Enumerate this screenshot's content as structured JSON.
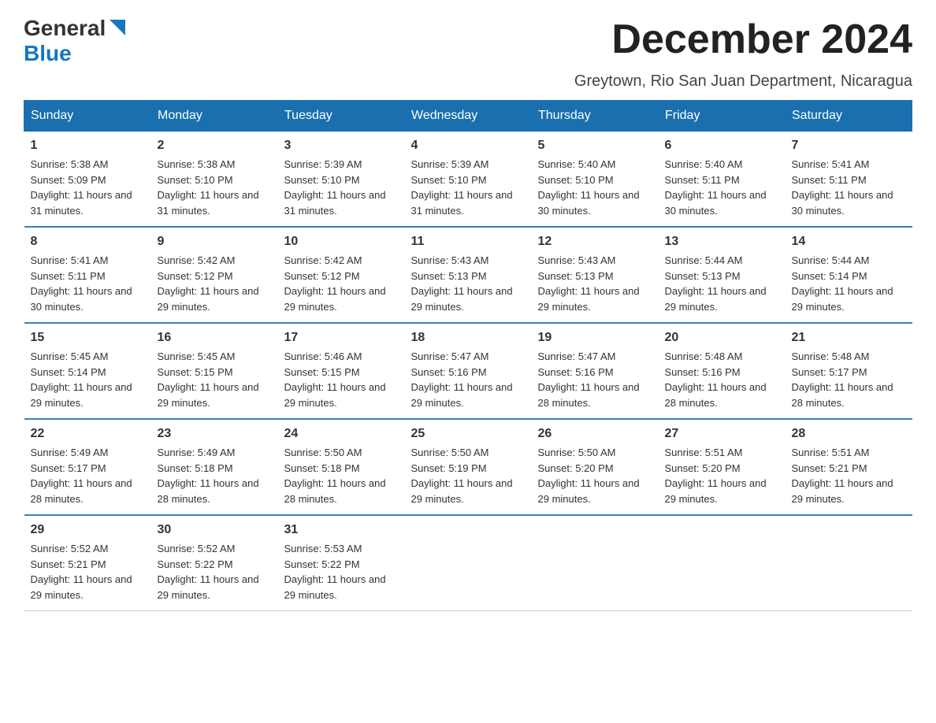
{
  "header": {
    "logo": {
      "general": "General",
      "blue": "Blue"
    },
    "month_title": "December 2024",
    "location": "Greytown, Rio San Juan Department, Nicaragua"
  },
  "calendar": {
    "days_of_week": [
      "Sunday",
      "Monday",
      "Tuesday",
      "Wednesday",
      "Thursday",
      "Friday",
      "Saturday"
    ],
    "weeks": [
      [
        {
          "day": "1",
          "sunrise": "5:38 AM",
          "sunset": "5:09 PM",
          "daylight": "11 hours and 31 minutes."
        },
        {
          "day": "2",
          "sunrise": "5:38 AM",
          "sunset": "5:10 PM",
          "daylight": "11 hours and 31 minutes."
        },
        {
          "day": "3",
          "sunrise": "5:39 AM",
          "sunset": "5:10 PM",
          "daylight": "11 hours and 31 minutes."
        },
        {
          "day": "4",
          "sunrise": "5:39 AM",
          "sunset": "5:10 PM",
          "daylight": "11 hours and 31 minutes."
        },
        {
          "day": "5",
          "sunrise": "5:40 AM",
          "sunset": "5:10 PM",
          "daylight": "11 hours and 30 minutes."
        },
        {
          "day": "6",
          "sunrise": "5:40 AM",
          "sunset": "5:11 PM",
          "daylight": "11 hours and 30 minutes."
        },
        {
          "day": "7",
          "sunrise": "5:41 AM",
          "sunset": "5:11 PM",
          "daylight": "11 hours and 30 minutes."
        }
      ],
      [
        {
          "day": "8",
          "sunrise": "5:41 AM",
          "sunset": "5:11 PM",
          "daylight": "11 hours and 30 minutes."
        },
        {
          "day": "9",
          "sunrise": "5:42 AM",
          "sunset": "5:12 PM",
          "daylight": "11 hours and 29 minutes."
        },
        {
          "day": "10",
          "sunrise": "5:42 AM",
          "sunset": "5:12 PM",
          "daylight": "11 hours and 29 minutes."
        },
        {
          "day": "11",
          "sunrise": "5:43 AM",
          "sunset": "5:13 PM",
          "daylight": "11 hours and 29 minutes."
        },
        {
          "day": "12",
          "sunrise": "5:43 AM",
          "sunset": "5:13 PM",
          "daylight": "11 hours and 29 minutes."
        },
        {
          "day": "13",
          "sunrise": "5:44 AM",
          "sunset": "5:13 PM",
          "daylight": "11 hours and 29 minutes."
        },
        {
          "day": "14",
          "sunrise": "5:44 AM",
          "sunset": "5:14 PM",
          "daylight": "11 hours and 29 minutes."
        }
      ],
      [
        {
          "day": "15",
          "sunrise": "5:45 AM",
          "sunset": "5:14 PM",
          "daylight": "11 hours and 29 minutes."
        },
        {
          "day": "16",
          "sunrise": "5:45 AM",
          "sunset": "5:15 PM",
          "daylight": "11 hours and 29 minutes."
        },
        {
          "day": "17",
          "sunrise": "5:46 AM",
          "sunset": "5:15 PM",
          "daylight": "11 hours and 29 minutes."
        },
        {
          "day": "18",
          "sunrise": "5:47 AM",
          "sunset": "5:16 PM",
          "daylight": "11 hours and 29 minutes."
        },
        {
          "day": "19",
          "sunrise": "5:47 AM",
          "sunset": "5:16 PM",
          "daylight": "11 hours and 28 minutes."
        },
        {
          "day": "20",
          "sunrise": "5:48 AM",
          "sunset": "5:16 PM",
          "daylight": "11 hours and 28 minutes."
        },
        {
          "day": "21",
          "sunrise": "5:48 AM",
          "sunset": "5:17 PM",
          "daylight": "11 hours and 28 minutes."
        }
      ],
      [
        {
          "day": "22",
          "sunrise": "5:49 AM",
          "sunset": "5:17 PM",
          "daylight": "11 hours and 28 minutes."
        },
        {
          "day": "23",
          "sunrise": "5:49 AM",
          "sunset": "5:18 PM",
          "daylight": "11 hours and 28 minutes."
        },
        {
          "day": "24",
          "sunrise": "5:50 AM",
          "sunset": "5:18 PM",
          "daylight": "11 hours and 28 minutes."
        },
        {
          "day": "25",
          "sunrise": "5:50 AM",
          "sunset": "5:19 PM",
          "daylight": "11 hours and 29 minutes."
        },
        {
          "day": "26",
          "sunrise": "5:50 AM",
          "sunset": "5:20 PM",
          "daylight": "11 hours and 29 minutes."
        },
        {
          "day": "27",
          "sunrise": "5:51 AM",
          "sunset": "5:20 PM",
          "daylight": "11 hours and 29 minutes."
        },
        {
          "day": "28",
          "sunrise": "5:51 AM",
          "sunset": "5:21 PM",
          "daylight": "11 hours and 29 minutes."
        }
      ],
      [
        {
          "day": "29",
          "sunrise": "5:52 AM",
          "sunset": "5:21 PM",
          "daylight": "11 hours and 29 minutes."
        },
        {
          "day": "30",
          "sunrise": "5:52 AM",
          "sunset": "5:22 PM",
          "daylight": "11 hours and 29 minutes."
        },
        {
          "day": "31",
          "sunrise": "5:53 AM",
          "sunset": "5:22 PM",
          "daylight": "11 hours and 29 minutes."
        },
        {
          "day": "",
          "sunrise": "",
          "sunset": "",
          "daylight": ""
        },
        {
          "day": "",
          "sunrise": "",
          "sunset": "",
          "daylight": ""
        },
        {
          "day": "",
          "sunrise": "",
          "sunset": "",
          "daylight": ""
        },
        {
          "day": "",
          "sunrise": "",
          "sunset": "",
          "daylight": ""
        }
      ]
    ]
  }
}
